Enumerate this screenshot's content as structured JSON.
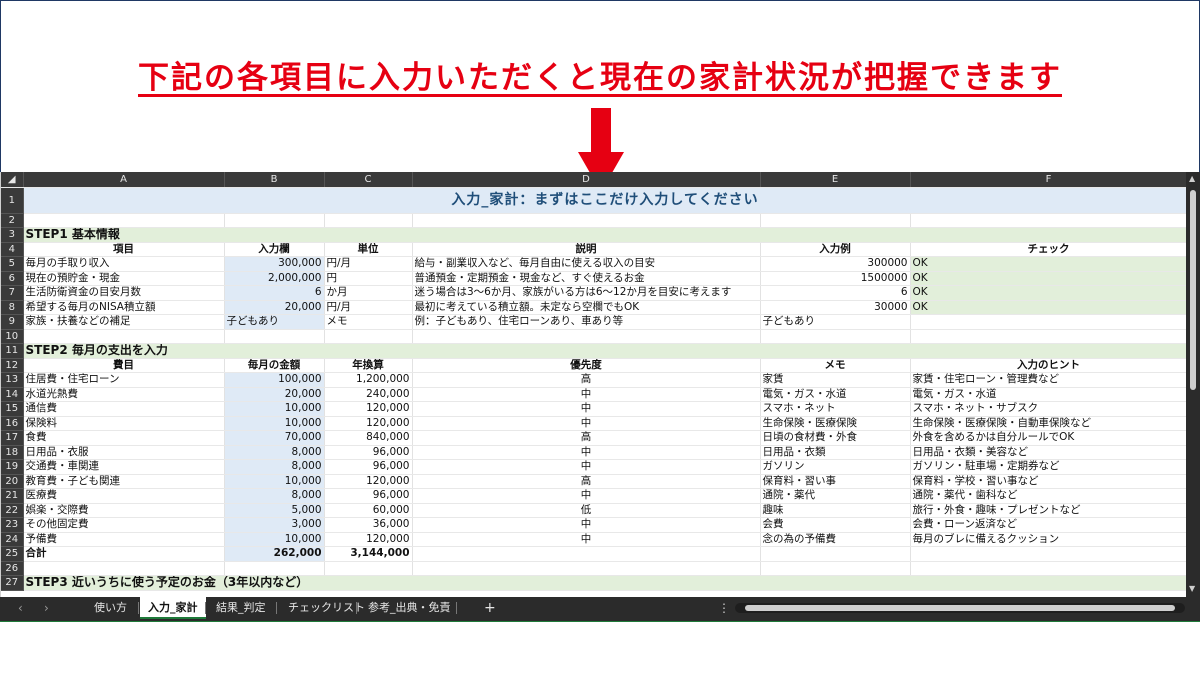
{
  "headline": "下記の各項目に入力いただくと現在の家計状況が把握できます",
  "columns": [
    "A",
    "B",
    "C",
    "D",
    "E",
    "F"
  ],
  "banner": "入力_家計：まずはここだけ入力してください",
  "step1": {
    "title": "STEP1 基本情報",
    "headers": [
      "項目",
      "入力欄",
      "単位",
      "説明",
      "入力例",
      "チェック"
    ],
    "rows": [
      [
        "毎月の手取り収入",
        "300,000",
        "円/月",
        "給与・副業収入など、毎月自由に使える収入の目安",
        "300000",
        "OK"
      ],
      [
        "現在の預貯金・現金",
        "2,000,000",
        "円",
        "普通預金・定期預金・現金など、すぐ使えるお金",
        "1500000",
        "OK"
      ],
      [
        "生活防衛資金の目安月数",
        "6",
        "か月",
        "迷う場合は3〜6か月、家族がいる方は6〜12か月を目安に考えます",
        "6",
        "OK"
      ],
      [
        "希望する毎月のNISA積立額",
        "20,000",
        "円/月",
        "最初に考えている積立額。未定なら空欄でもOK",
        "30000",
        "OK"
      ],
      [
        "家族・扶養などの補足",
        "子どもあり",
        "メモ",
        "例：子どもあり、住宅ローンあり、車あり等",
        "子どもあり",
        ""
      ]
    ]
  },
  "step2": {
    "title": "STEP2 毎月の支出を入力",
    "headers": [
      "費目",
      "毎月の金額",
      "年換算",
      "優先度",
      "メモ",
      "入力のヒント"
    ],
    "rows": [
      [
        "住居費・住宅ローン",
        "100,000",
        "1,200,000",
        "高",
        "家賃",
        "家賃・住宅ローン・管理費など"
      ],
      [
        "水道光熱費",
        "20,000",
        "240,000",
        "中",
        "電気・ガス・水道",
        "電気・ガス・水道"
      ],
      [
        "通信費",
        "10,000",
        "120,000",
        "中",
        "スマホ・ネット",
        "スマホ・ネット・サブスク"
      ],
      [
        "保険料",
        "10,000",
        "120,000",
        "中",
        "生命保険・医療保険",
        "生命保険・医療保険・自動車保険など"
      ],
      [
        "食費",
        "70,000",
        "840,000",
        "高",
        "日頃の食材費・外食",
        "外食を含めるかは自分ルールでOK"
      ],
      [
        "日用品・衣服",
        "8,000",
        "96,000",
        "中",
        "日用品・衣類",
        "日用品・衣類・美容など"
      ],
      [
        "交通費・車関連",
        "8,000",
        "96,000",
        "中",
        "ガソリン",
        "ガソリン・駐車場・定期券など"
      ],
      [
        "教育費・子ども関連",
        "10,000",
        "120,000",
        "高",
        "保育料・習い事",
        "保育料・学校・習い事など"
      ],
      [
        "医療費",
        "8,000",
        "96,000",
        "中",
        "通院・薬代",
        "通院・薬代・歯科など"
      ],
      [
        "娯楽・交際費",
        "5,000",
        "60,000",
        "低",
        "趣味",
        "旅行・外食・趣味・プレゼントなど"
      ],
      [
        "その他固定費",
        "3,000",
        "36,000",
        "中",
        "会費",
        "会費・ローン返済など"
      ],
      [
        "予備費",
        "10,000",
        "120,000",
        "中",
        "念の為の予備費",
        "毎月のブレに備えるクッション"
      ]
    ],
    "total_label": "合計",
    "total_monthly": "262,000",
    "total_annual": "3,144,000"
  },
  "step3": {
    "title": "STEP3 近いうちに使う予定のお金（3年以内など）"
  },
  "tabs": [
    "使い方",
    "入力_家計",
    "結果_判定",
    "チェックリスト",
    "参考_出典・免責"
  ],
  "active_tab": "入力_家計",
  "add_sheet": "+",
  "colors": {
    "headline": "#e60012",
    "input_fill": "#dfeaf6",
    "check_fill": "#e2efda",
    "banner_text": "#1f4e79"
  }
}
